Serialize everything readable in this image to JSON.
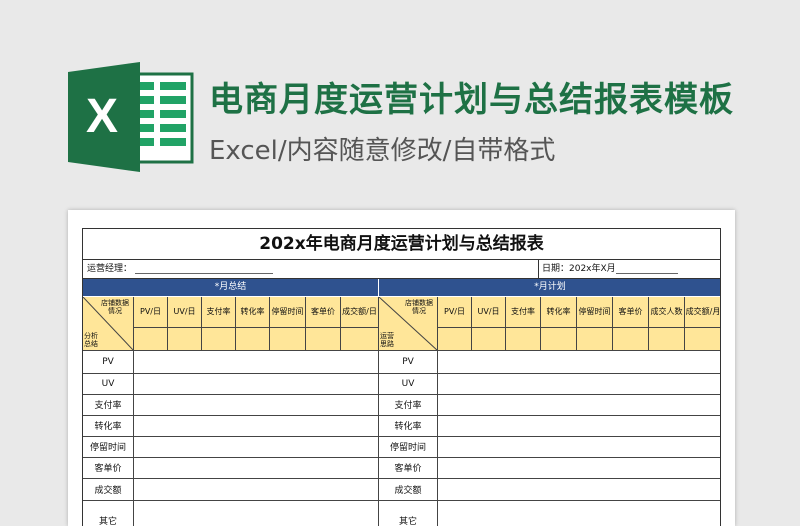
{
  "header": {
    "logo_letter": "X",
    "title": "电商月度运营计划与总结报表模板",
    "subtitle": "Excel/内容随意修改/自带格式",
    "colors": {
      "title": "#1e7145",
      "band": "#2f528f",
      "header_fill": "#ffe699"
    }
  },
  "sheet": {
    "title": "202x年电商月度运营计划与总结报表",
    "manager_label": "运营经理：",
    "date_label": "日期：202x年X月",
    "left_band": "*月总结",
    "right_band": "*月计划",
    "left_diag": {
      "top": "店铺数据情况",
      "bottom": "分析总结"
    },
    "right_diag": {
      "top": "店铺数据情况",
      "bottom": "运营思路"
    },
    "left_cols": [
      "PV/日",
      "UV/日",
      "支付率",
      "转化率",
      "停留时间",
      "客单价",
      "成交额/日"
    ],
    "right_cols": [
      "PV/日",
      "UV/日",
      "支付率",
      "转化率",
      "停留时间",
      "客单价",
      "成交人数",
      "成交额/月"
    ],
    "rows": [
      "PV",
      "UV",
      "支付率",
      "转化率",
      "停留时间",
      "客单价",
      "成交额",
      "其它"
    ]
  }
}
